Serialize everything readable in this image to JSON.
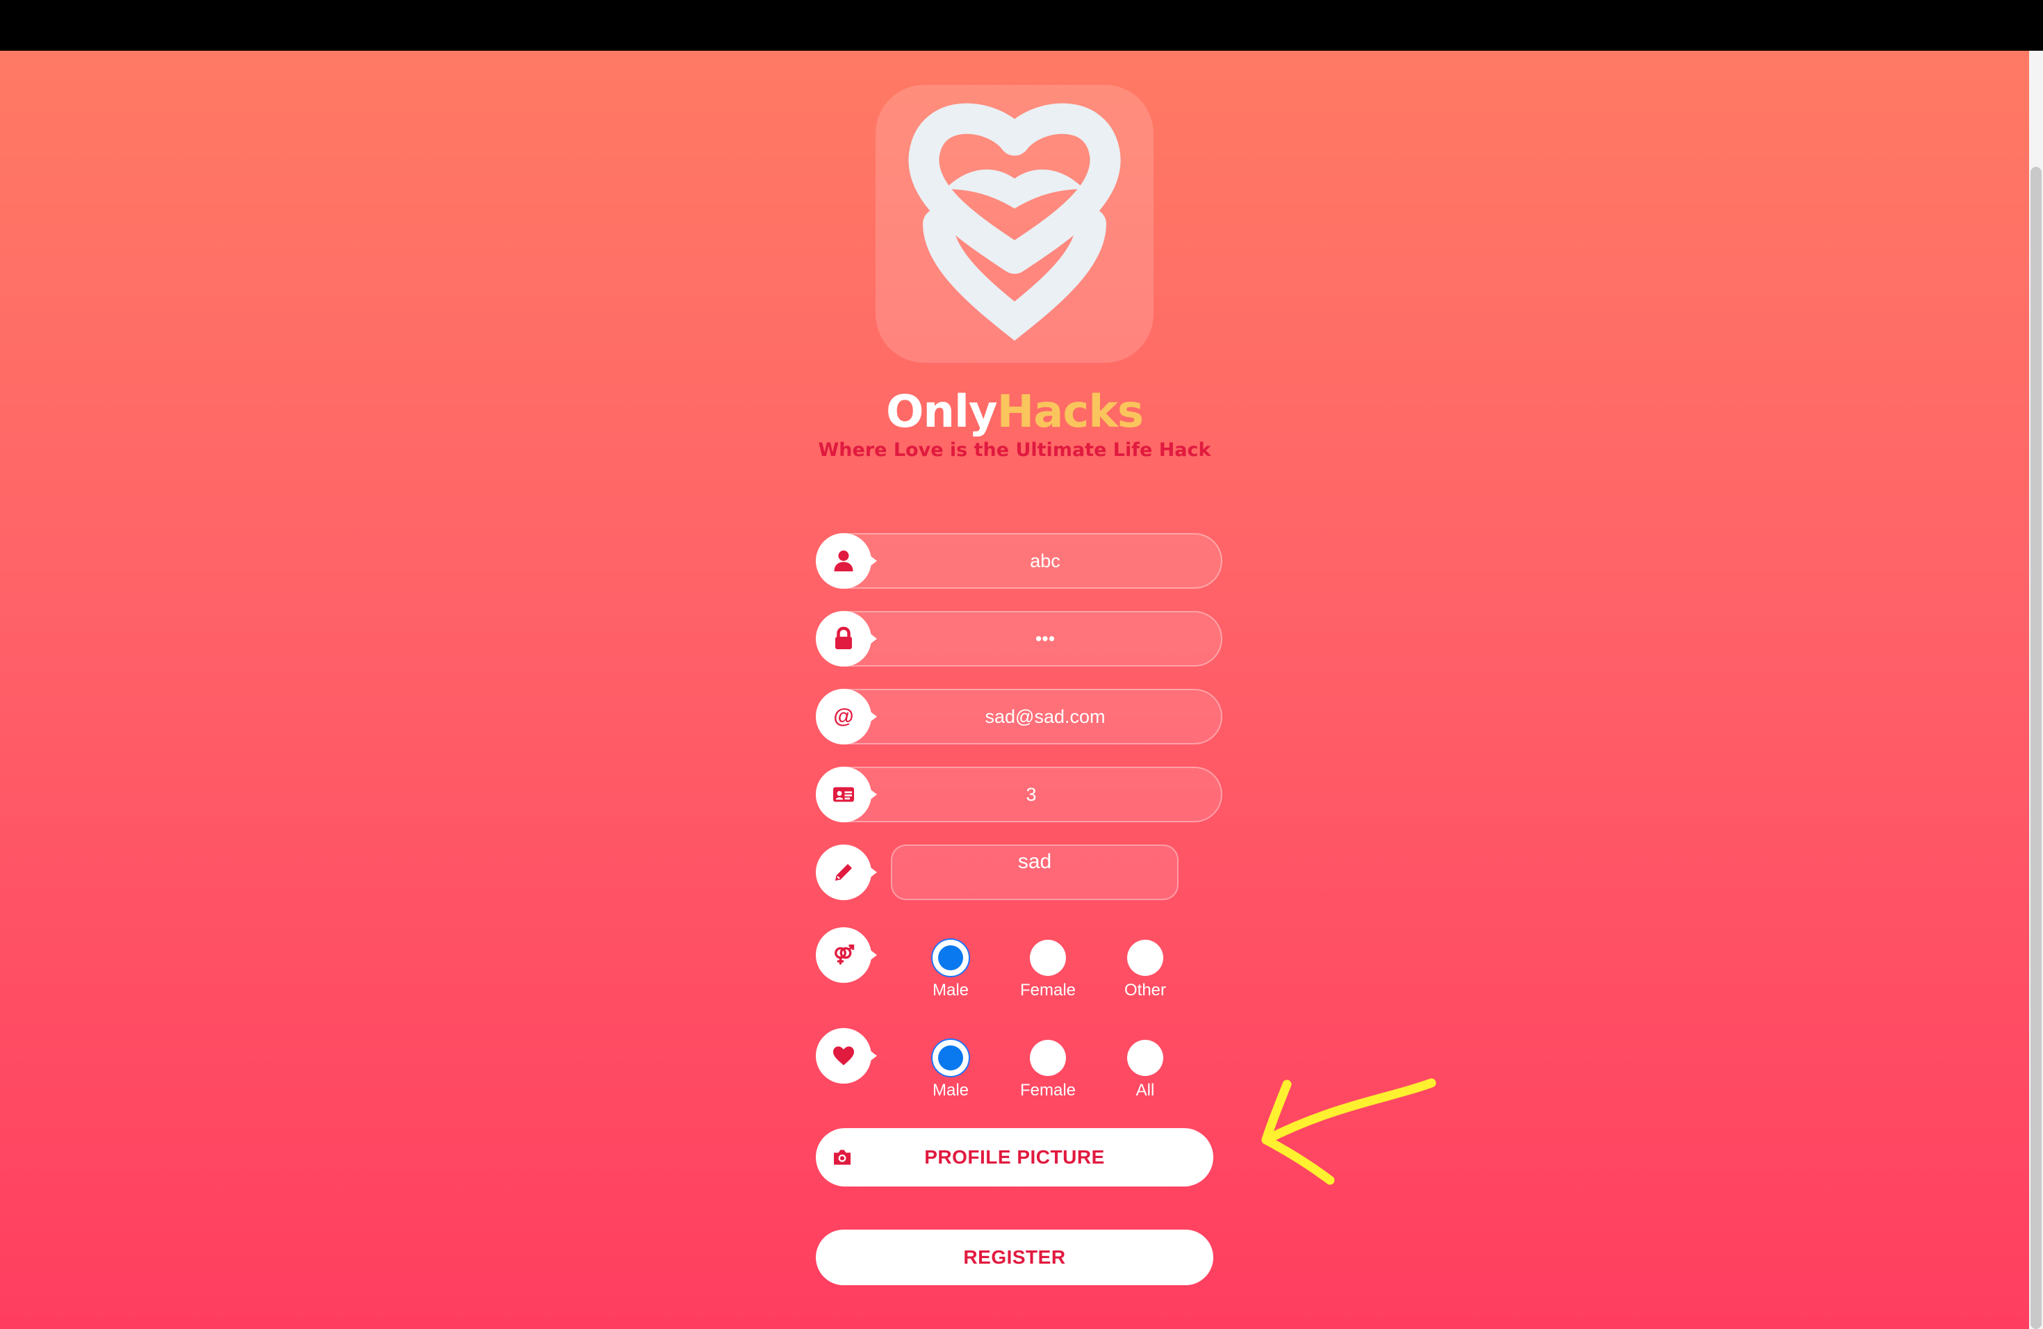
{
  "brand": {
    "name_part1": "Only",
    "name_part2": "Hacks",
    "tagline": "Where Love is the Ultimate Life Hack"
  },
  "form": {
    "username": "abc",
    "password": "•••",
    "email": "sad@sad.com",
    "age": "3",
    "bio": "sad",
    "gender": {
      "options": [
        "Male",
        "Female",
        "Other"
      ],
      "selected": "Male"
    },
    "interested_in": {
      "options": [
        "Male",
        "Female",
        "All"
      ],
      "selected": "Male"
    }
  },
  "buttons": {
    "profile_picture": "PROFILE PICTURE",
    "register": "REGISTER"
  },
  "icons": {
    "username": "user-icon",
    "password": "lock-icon",
    "email": "at-sign-icon",
    "age": "id-card-icon",
    "bio": "pencil-icon",
    "gender": "gender-icon",
    "interest": "heart-icon",
    "photo": "camera-icon"
  },
  "colors": {
    "accent": "#e11a3f",
    "brand_yellow": "#f9c55c",
    "radio_selected": "#0a78ee",
    "annotation_arrow": "#fff030"
  }
}
